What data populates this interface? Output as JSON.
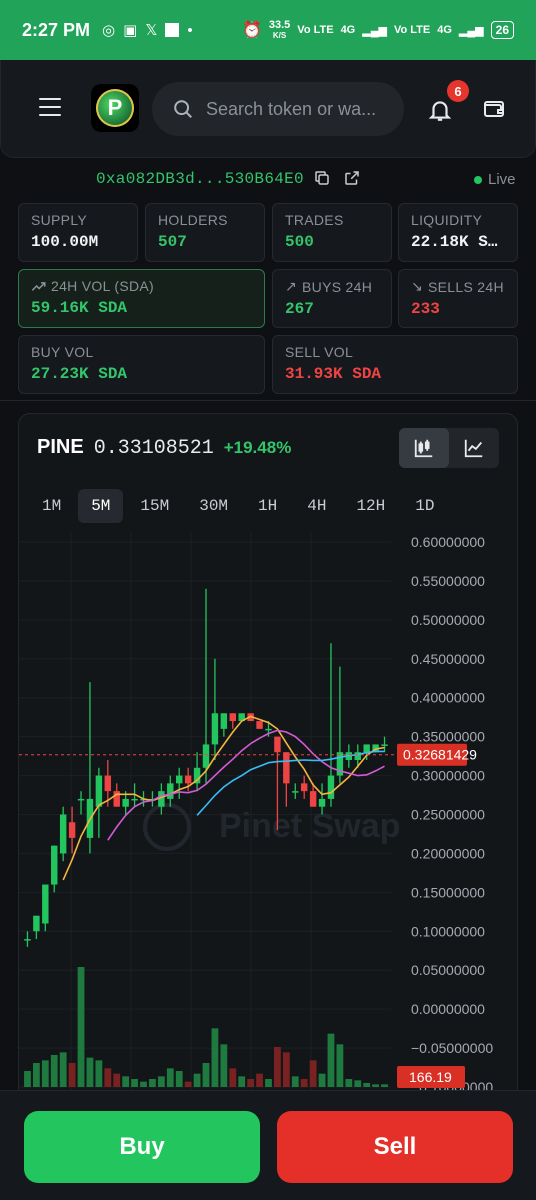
{
  "status": {
    "time": "2:27 PM",
    "speed": "33.5",
    "speed_unit": "K/S",
    "net1": "Vo LTE",
    "net1_gen": "4G",
    "net2": "Vo LTE",
    "net2_gen": "4G",
    "battery": "26"
  },
  "header": {
    "search_placeholder": "Search token or wa...",
    "notifications": "6"
  },
  "token": {
    "address": "0xa082DB3d...530B64E0",
    "live": "Live"
  },
  "stats": [
    {
      "label": "SUPPLY",
      "value": "100.00M",
      "tone": "white"
    },
    {
      "label": "HOLDERS",
      "value": "507",
      "tone": "green"
    },
    {
      "label": "TRADES",
      "value": "500",
      "tone": "green"
    },
    {
      "label": "LIQUIDITY",
      "value": "22.18K S…",
      "tone": "white"
    },
    {
      "label": "24H VOL (SDA)",
      "value": "59.16K SDA",
      "tone": "green"
    },
    {
      "label": "BUYS 24H",
      "value": "267",
      "tone": "green"
    },
    {
      "label": "SELLS 24H",
      "value": "233",
      "tone": "red"
    },
    {
      "label": "BUY VOL",
      "value": "27.23K SDA",
      "tone": "green"
    },
    {
      "label": "SELL VOL",
      "value": "31.93K SDA",
      "tone": "red"
    }
  ],
  "chart": {
    "symbol": "PINE",
    "price": "0.33108521",
    "change": "+19.48%",
    "timeframes": [
      "1M",
      "5M",
      "15M",
      "30M",
      "1H",
      "4H",
      "12H",
      "1D"
    ],
    "active_timeframe": "5M",
    "watermark": "Pinet Swap",
    "last_price_label": "0.32681429",
    "volume_label": "166.19"
  },
  "chart_data": {
    "type": "candlestick",
    "y_ticks": [
      "0.60000000",
      "0.55000000",
      "0.50000000",
      "0.45000000",
      "0.40000000",
      "0.35000000",
      "0.30000000",
      "0.25000000",
      "0.20000000",
      "0.15000000",
      "0.10000000",
      "0.05000000",
      "0.00000000",
      "−0.05000000",
      "−0.10000000"
    ],
    "ylim": [
      -0.1,
      0.6
    ],
    "last_price": 0.32681429,
    "candles": [
      [
        0.09,
        0.1,
        0.08,
        0.09
      ],
      [
        0.1,
        0.11,
        0.09,
        0.12
      ],
      [
        0.11,
        0.16,
        0.1,
        0.16
      ],
      [
        0.16,
        0.21,
        0.15,
        0.21
      ],
      [
        0.2,
        0.26,
        0.19,
        0.25
      ],
      [
        0.24,
        0.26,
        0.2,
        0.22
      ],
      [
        0.27,
        0.28,
        0.25,
        0.27
      ],
      [
        0.22,
        0.42,
        0.2,
        0.27
      ],
      [
        0.26,
        0.31,
        0.22,
        0.3
      ],
      [
        0.3,
        0.32,
        0.26,
        0.28
      ],
      [
        0.28,
        0.29,
        0.26,
        0.26
      ],
      [
        0.26,
        0.28,
        0.25,
        0.27
      ],
      [
        0.27,
        0.29,
        0.26,
        0.27
      ],
      [
        0.27,
        0.28,
        0.26,
        0.27
      ],
      [
        0.27,
        0.28,
        0.26,
        0.27
      ],
      [
        0.26,
        0.29,
        0.25,
        0.28
      ],
      [
        0.27,
        0.3,
        0.26,
        0.29
      ],
      [
        0.29,
        0.31,
        0.27,
        0.3
      ],
      [
        0.3,
        0.31,
        0.28,
        0.29
      ],
      [
        0.29,
        0.33,
        0.28,
        0.31
      ],
      [
        0.31,
        0.54,
        0.29,
        0.34
      ],
      [
        0.34,
        0.45,
        0.32,
        0.38
      ],
      [
        0.36,
        0.38,
        0.35,
        0.38
      ],
      [
        0.38,
        0.38,
        0.36,
        0.37
      ],
      [
        0.37,
        0.38,
        0.37,
        0.38
      ],
      [
        0.38,
        0.38,
        0.37,
        0.37
      ],
      [
        0.37,
        0.37,
        0.36,
        0.36
      ],
      [
        0.36,
        0.37,
        0.35,
        0.36
      ],
      [
        0.35,
        0.35,
        0.23,
        0.33
      ],
      [
        0.33,
        0.33,
        0.26,
        0.29
      ],
      [
        0.28,
        0.29,
        0.27,
        0.28
      ],
      [
        0.29,
        0.3,
        0.27,
        0.28
      ],
      [
        0.28,
        0.29,
        0.26,
        0.26
      ],
      [
        0.26,
        0.29,
        0.25,
        0.27
      ],
      [
        0.27,
        0.47,
        0.26,
        0.3
      ],
      [
        0.3,
        0.44,
        0.29,
        0.33
      ],
      [
        0.32,
        0.34,
        0.31,
        0.33
      ],
      [
        0.32,
        0.34,
        0.31,
        0.33
      ],
      [
        0.33,
        0.34,
        0.32,
        0.34
      ],
      [
        0.33,
        0.34,
        0.33,
        0.34
      ],
      [
        0.34,
        0.35,
        0.33,
        0.34
      ]
    ],
    "volumes": [
      12,
      18,
      20,
      24,
      26,
      18,
      90,
      22,
      20,
      14,
      10,
      8,
      6,
      4,
      6,
      8,
      14,
      12,
      4,
      10,
      18,
      44,
      32,
      14,
      8,
      6,
      10,
      6,
      30,
      26,
      8,
      6,
      20,
      10,
      40,
      32,
      6,
      5,
      3,
      2,
      2
    ],
    "ma": [
      {
        "color": "#f5b73b",
        "period": 5
      },
      {
        "color": "#d35bd6",
        "period": 10
      },
      {
        "color": "#38bdf8",
        "period": 20
      }
    ]
  }
}
